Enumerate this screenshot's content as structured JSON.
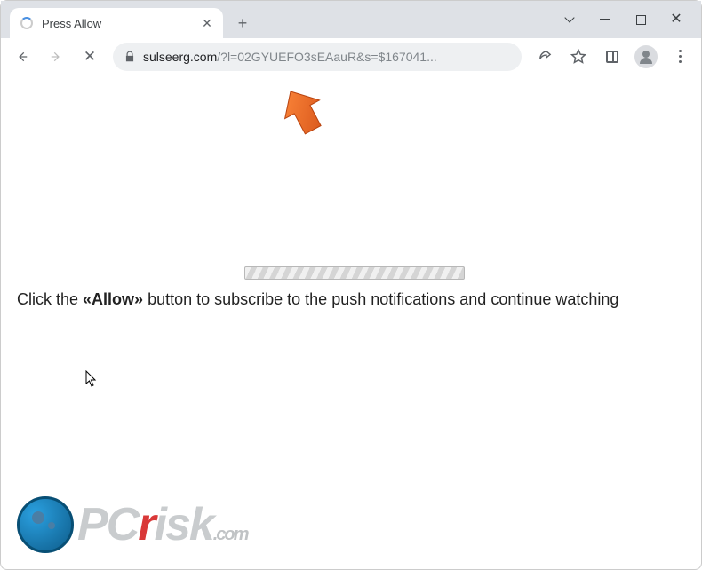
{
  "tab": {
    "title": "Press Allow"
  },
  "url": {
    "domain": "sulseerg.com",
    "path": "/?l=02GYUEFO3sEAauR&s=$167041..."
  },
  "page": {
    "instruction_prefix": "Click the ",
    "instruction_bold": "«Allow»",
    "instruction_suffix": " button to subscribe to the push notifications and continue watching"
  },
  "watermark": {
    "prefix": "PC",
    "accent": "r",
    "rest": "isk",
    "ext": ".com"
  }
}
